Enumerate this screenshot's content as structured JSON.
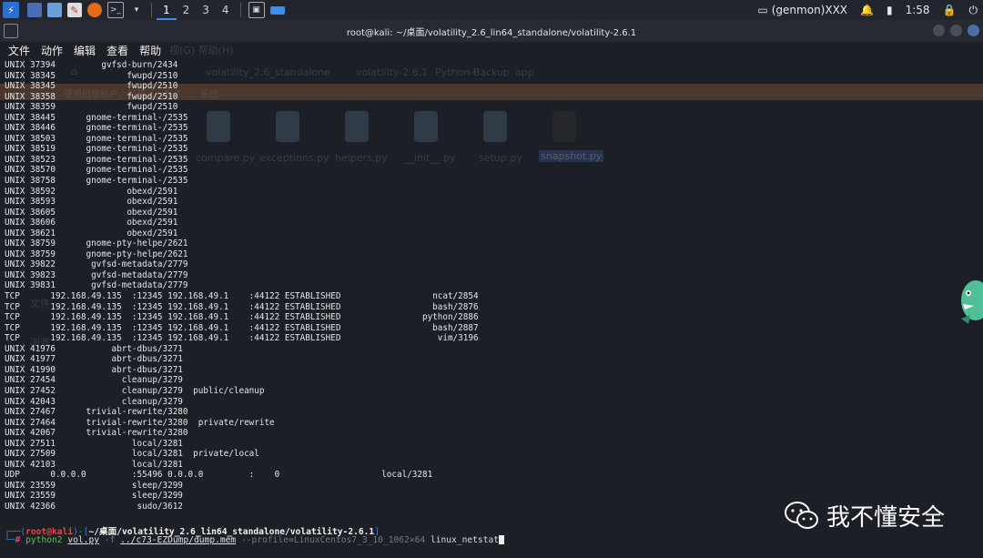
{
  "taskbar": {
    "workspaces": [
      "1",
      "2",
      "3",
      "4"
    ],
    "active_workspace": "1",
    "tray_label": "(genmon)XXX",
    "time": "1:58"
  },
  "window": {
    "title": "root@kali: ~/桌面/volatility_2.6_lin64_standalone/volatility-2.6.1"
  },
  "menu": [
    "文件",
    "动作",
    "编辑",
    "查看",
    "帮助"
  ],
  "ghost": {
    "menu_frag": "视(G)  帮助(H)",
    "path": [
      "volatility_2.6_standalone",
      "volatility-2.6.1",
      "Python-Backup",
      "app"
    ],
    "band": "使用旧版帐户，可能……为了……系统",
    "files": [
      "compare.py",
      "exceptions.py",
      "helpers.py",
      "__init__.py",
      "setup.py",
      "snapshot.py"
    ],
    "side1": "文件",
    "side2": "浏览"
  },
  "output": [
    "UNIX 37394         gvfsd-burn/2434",
    "UNIX 38345              fwupd/2510",
    "UNIX 38345              fwupd/2510",
    "UNIX 38358              fwupd/2510",
    "UNIX 38359              fwupd/2510",
    "UNIX 38445      gnome-terminal-/2535",
    "UNIX 38446      gnome-terminal-/2535",
    "UNIX 38503      gnome-terminal-/2535",
    "UNIX 38519      gnome-terminal-/2535",
    "UNIX 38523      gnome-terminal-/2535",
    "UNIX 38570      gnome-terminal-/2535",
    "UNIX 38758      gnome-terminal-/2535",
    "UNIX 38592              obexd/2591",
    "UNIX 38593              obexd/2591",
    "UNIX 38605              obexd/2591",
    "UNIX 38606              obexd/2591",
    "UNIX 38621              obexd/2591",
    "UNIX 38759      gnome-pty-helpe/2621",
    "UNIX 38759      gnome-pty-helpe/2621",
    "UNIX 39822       gvfsd-metadata/2779",
    "UNIX 39823       gvfsd-metadata/2779",
    "UNIX 39831       gvfsd-metadata/2779",
    "TCP      192.168.49.135  :12345 192.168.49.1    :44122 ESTABLISHED                  ncat/2854",
    "TCP      192.168.49.135  :12345 192.168.49.1    :44122 ESTABLISHED                  bash/2876",
    "TCP      192.168.49.135  :12345 192.168.49.1    :44122 ESTABLISHED                python/2886",
    "TCP      192.168.49.135  :12345 192.168.49.1    :44122 ESTABLISHED                  bash/2887",
    "TCP      192.168.49.135  :12345 192.168.49.1    :44122 ESTABLISHED                   vim/3196",
    "UNIX 41976           abrt-dbus/3271",
    "UNIX 41977           abrt-dbus/3271",
    "UNIX 41990           abrt-dbus/3271",
    "UNIX 27454             cleanup/3279",
    "UNIX 27452             cleanup/3279  public/cleanup",
    "UNIX 42043             cleanup/3279",
    "UNIX 27467      trivial-rewrite/3280",
    "UNIX 27464      trivial-rewrite/3280  private/rewrite",
    "UNIX 42067      trivial-rewrite/3280",
    "UNIX 27511               local/3281",
    "UNIX 27509               local/3281  private/local",
    "UNIX 42103               local/3281",
    "UDP      0.0.0.0         :55496 0.0.0.0         :    0                    local/3281",
    "UNIX 23559               sleep/3299",
    "UNIX 23559               sleep/3299",
    "UNIX 42366                sudo/3612"
  ],
  "prompt": {
    "user": "root",
    "at": "@",
    "host": "kali",
    "path": "~/桌面/volatility_2.6_lin64_standalone/volatility-2.6.1",
    "cmd": "python2",
    "script": "vol.py",
    "flag": "-f",
    "file": "../c73-EZDump/dump.mem",
    "profile_arg": "--profile=LinuxCentos7_3_10_1062×64",
    "plugin": "linux_netstat"
  },
  "watermark": "我不懂安全"
}
